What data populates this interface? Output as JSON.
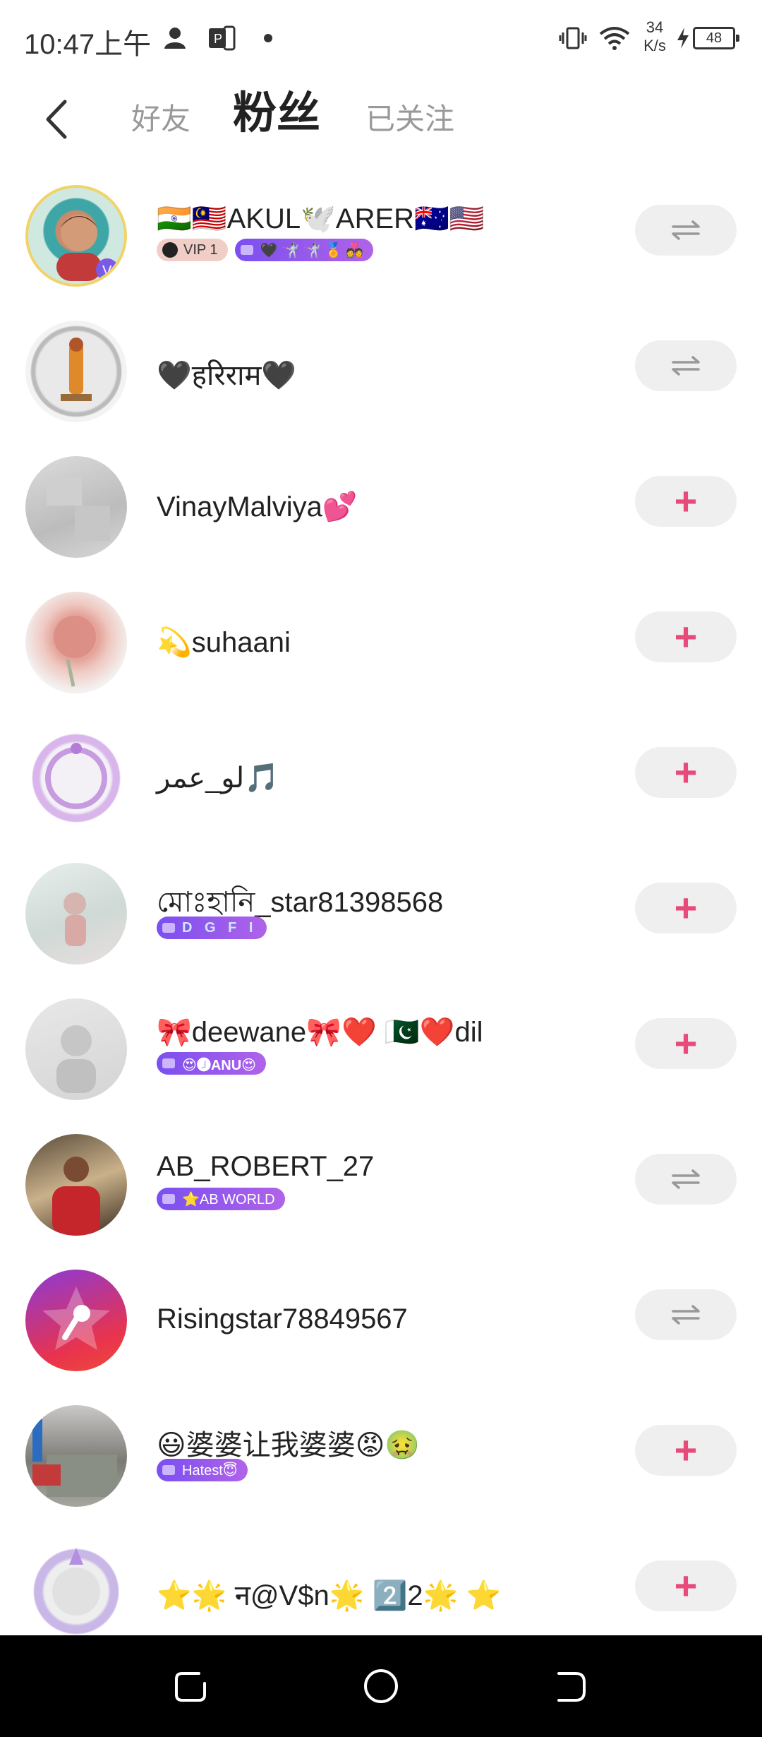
{
  "status": {
    "time": "10:47上午",
    "speed_value": "34",
    "speed_unit": "K/s",
    "battery": "48"
  },
  "header": {
    "tabs": [
      {
        "label": "好友"
      },
      {
        "label": "粉丝"
      },
      {
        "label": "已关注"
      }
    ]
  },
  "users": [
    {
      "name": "🇮🇳🇲🇾AKUL🕊️ARER🇦🇺🇺🇸",
      "vip": "VIP 1",
      "family": "🖤 🤺 🤺 🏅 💑",
      "action": "mutual"
    },
    {
      "name": "🖤हरिराम🖤",
      "action": "mutual"
    },
    {
      "name": "VinayMalviya💕",
      "action": "follow"
    },
    {
      "name": "💫suhaani",
      "action": "follow"
    },
    {
      "name": "لو_عمر🎵",
      "action": "follow"
    },
    {
      "name": "মোঃহানি_star81398568",
      "family": "D G F I",
      "action": "follow"
    },
    {
      "name": "🎀deewane🎀❤️ 🇵🇰❤️dil",
      "family": "😍🅙ANU😍",
      "action": "follow"
    },
    {
      "name": "AB_ROBERT_27",
      "family": "⭐AB WORLD",
      "action": "mutual"
    },
    {
      "name": "Risingstar78849567",
      "action": "mutual"
    },
    {
      "name": "😃婆婆让我婆婆😡🤢",
      "family": "Hatest😇",
      "action": "follow"
    },
    {
      "name": "⭐🌟 न@V$n🌟 2️⃣2🌟 ⭐",
      "action": "follow"
    }
  ],
  "colors": {
    "accent": "#e84a7a",
    "family_badge": "#7a4ff0",
    "button_bg": "#efefef"
  },
  "icons": {
    "back": "back-arrow-icon",
    "mutual": "mutual-follow-icon",
    "follow": "plus-icon"
  }
}
